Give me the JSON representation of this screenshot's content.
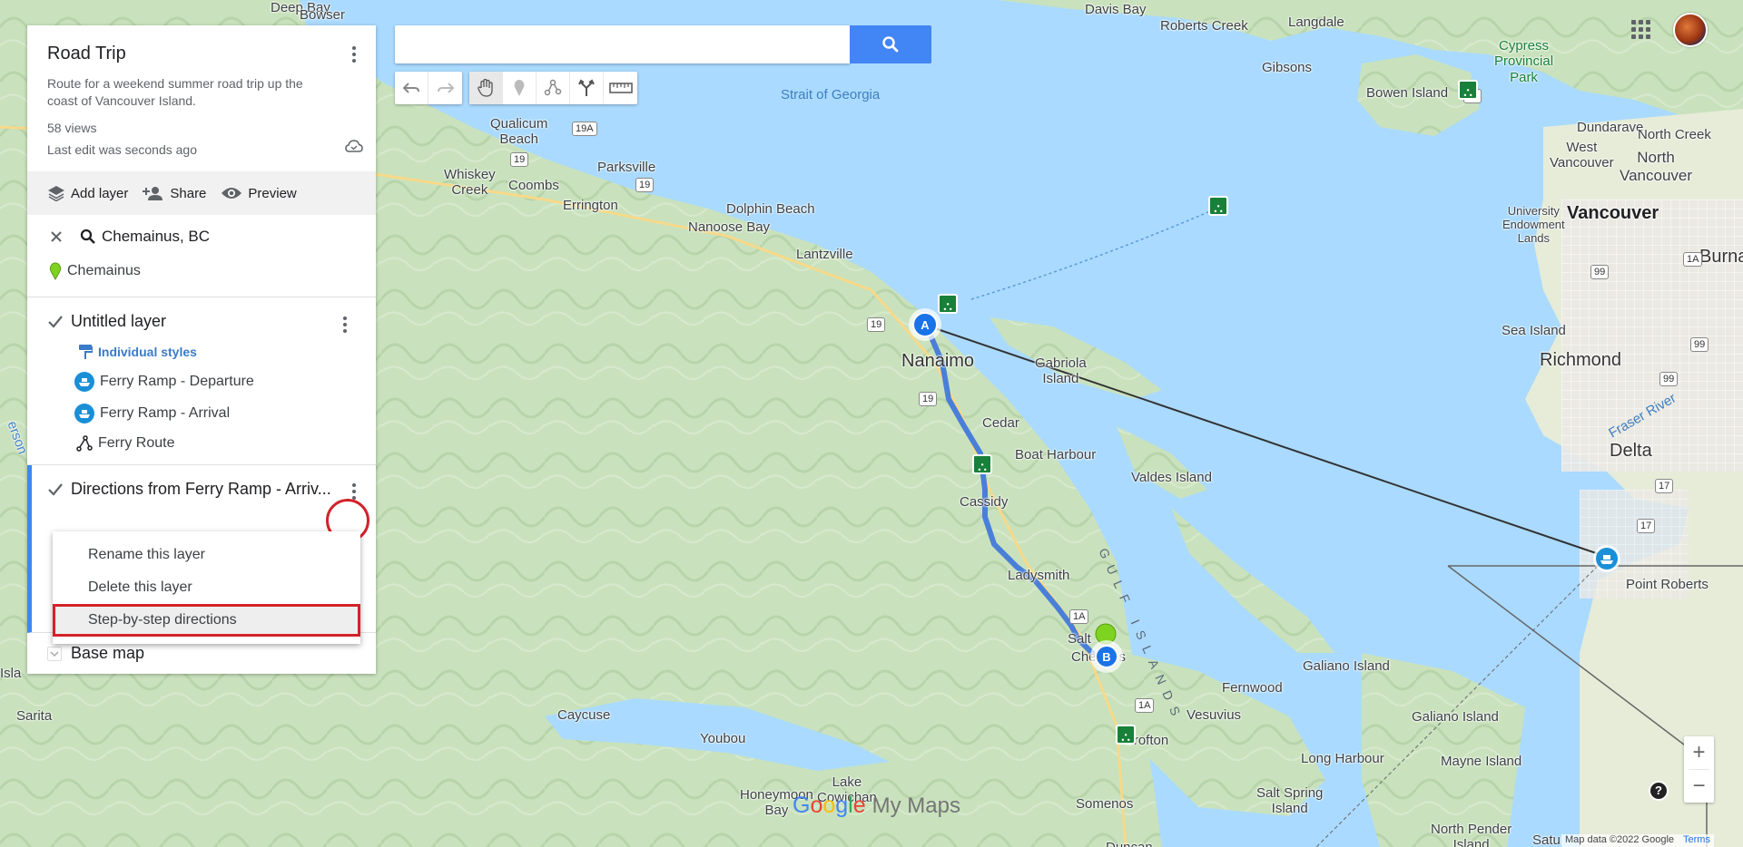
{
  "search": {
    "placeholder": "",
    "value": ""
  },
  "panel": {
    "title": "Road Trip",
    "description": "Route for a weekend summer road trip up the coast of Vancouver Island.",
    "views": "58 views",
    "last_edit": "Last edit was seconds ago",
    "actions": {
      "add_layer": "Add layer",
      "share": "Share",
      "preview": "Preview"
    },
    "search_result": {
      "query": "Chemainus, BC",
      "place": "Chemainus"
    },
    "layers": [
      {
        "name": "Untitled layer",
        "checked": true,
        "styles_label": "Individual styles",
        "features": [
          "Ferry Ramp - Departure",
          "Ferry Ramp - Arrival",
          "Ferry Route"
        ]
      },
      {
        "name": "Directions from Ferry Ramp - Arriv...",
        "checked": true
      }
    ],
    "base_map": "Base map"
  },
  "context_menu": {
    "items": [
      "Rename this layer",
      "Delete this layer",
      "Step-by-step directions"
    ],
    "highlighted_index": 2
  },
  "map": {
    "labels": {
      "deep_bay": "Deep Bay",
      "bowser": "Bowser",
      "davis_bay": "Davis Bay",
      "roberts_creek": "Roberts Creek",
      "langdale": "Langdale",
      "gibsons": "Gibsons",
      "cypress_park": "Cypress\nProvincial\nPark",
      "bowen_island": "Bowen Island",
      "dundarave": "Dundarave",
      "north_creek": "North Creek",
      "west_vancouver": "West\nVancouver",
      "north_vancouver": "North\nVancouver",
      "strait_of_georgia": "Strait of Georgia",
      "qualicum_beach": "Qualicum\nBeach",
      "parksville": "Parksville",
      "whiskey_creek": "Whiskey\nCreek",
      "coombs": "Coombs",
      "errington": "Errington",
      "dolphin_beach": "Dolphin Beach",
      "nanoose_bay": "Nanoose Bay",
      "university_lands": "University\nEndowment\nLands",
      "vancouver": "Vancouver",
      "burnaby": "Burna",
      "lantzville": "Lantzville",
      "nanaimo": "Nanaimo",
      "gabriola_island": "Gabriola\nIsland",
      "sea_island": "Sea Island",
      "richmond": "Richmond",
      "fraser_river": "Fraser River",
      "cedar": "Cedar",
      "boat_harbour": "Boat Harbour",
      "delta": "Delta",
      "valdes_island": "Valdes Island",
      "cassidy": "Cassidy",
      "gulf_islands": "GULF ISLANDS",
      "ladysmith": "Ladysmith",
      "point_roberts": "Point Roberts",
      "saltair": "Salt",
      "chemainus": "Che    us",
      "galiano_island": "Galiano Island",
      "galiano_island_2": "Galiano Island",
      "fernwood": "Fernwood",
      "vesuvius": "Vesuvius",
      "crofton": "Crofton",
      "cycoose": "Caycuse",
      "youbou": "Youbou",
      "sarita": "Sarita",
      "long_harbour": "Long Harbour",
      "mayne_island": "Mayne Island",
      "lake_cowichan": "Lake\nCowichan",
      "honeymoon_bay": "Honeymoon\nBay",
      "salt_spring_island": "Salt Spring\nIsland",
      "somenos": "Somenos",
      "north_pender": "North Pender\nIsland",
      "satu": "Satu",
      "duncan": "Duncan",
      "isla": "Isla",
      "erson": "erson"
    },
    "highway_shields": [
      "19A",
      "19",
      "19",
      "19",
      "19",
      "19",
      "99",
      "99",
      "99",
      "1A",
      "99",
      "17",
      "17",
      "1A",
      "1A",
      "1A"
    ],
    "markers": {
      "a": "A",
      "b": "B"
    }
  },
  "logo": {
    "google": "Google",
    "my_maps": "My Maps"
  },
  "footer": {
    "map_data": "Map data ©2022 Google",
    "terms": "Terms"
  },
  "zoom": {
    "in": "+",
    "out": "−"
  },
  "help": "?",
  "colors": {
    "accent": "#4285f4",
    "highlight_red": "#d3222a",
    "water": "#aadaff",
    "land": "#c8e6c2",
    "route": "#4a7fd9"
  }
}
